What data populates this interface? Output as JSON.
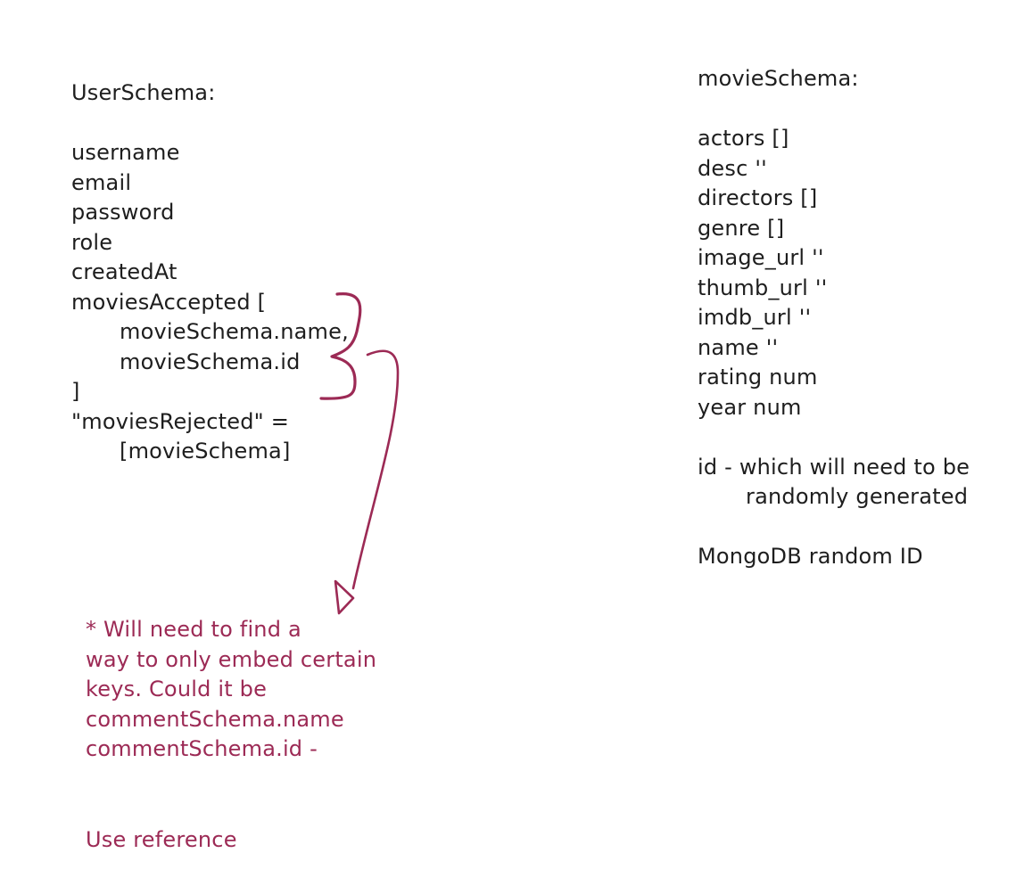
{
  "colors": {
    "ink": "#1e1e1e",
    "accent": "#9c2a55",
    "background": "#ffffff"
  },
  "user_schema": {
    "title": "UserSchema:",
    "fields": [
      "username",
      "email",
      "password",
      "role",
      "createdAt"
    ],
    "movies_accepted": {
      "open": "moviesAccepted [",
      "items": [
        "movieSchema.name,",
        "movieSchema.id"
      ],
      "close": "]"
    },
    "movies_rejected": {
      "line1": "\"moviesRejected\" =",
      "line2": "[movieSchema]"
    }
  },
  "movie_schema": {
    "title": "movieSchema:",
    "fields": [
      "actors []",
      "desc ''",
      "directors []",
      "genre []",
      "image_url ''",
      "thumb_url ''",
      "imdb_url ''",
      "name ''",
      "rating num",
      "year num"
    ],
    "id_note": [
      "id - which will need to be",
      "randomly generated"
    ],
    "mongo_note": "MongoDB random ID"
  },
  "note": {
    "lines": [
      "* Will need to find a",
      "way to only embed certain",
      "keys. Could it be",
      "commentSchema.name",
      "commentSchema.id -"
    ],
    "footer": "Use reference"
  }
}
